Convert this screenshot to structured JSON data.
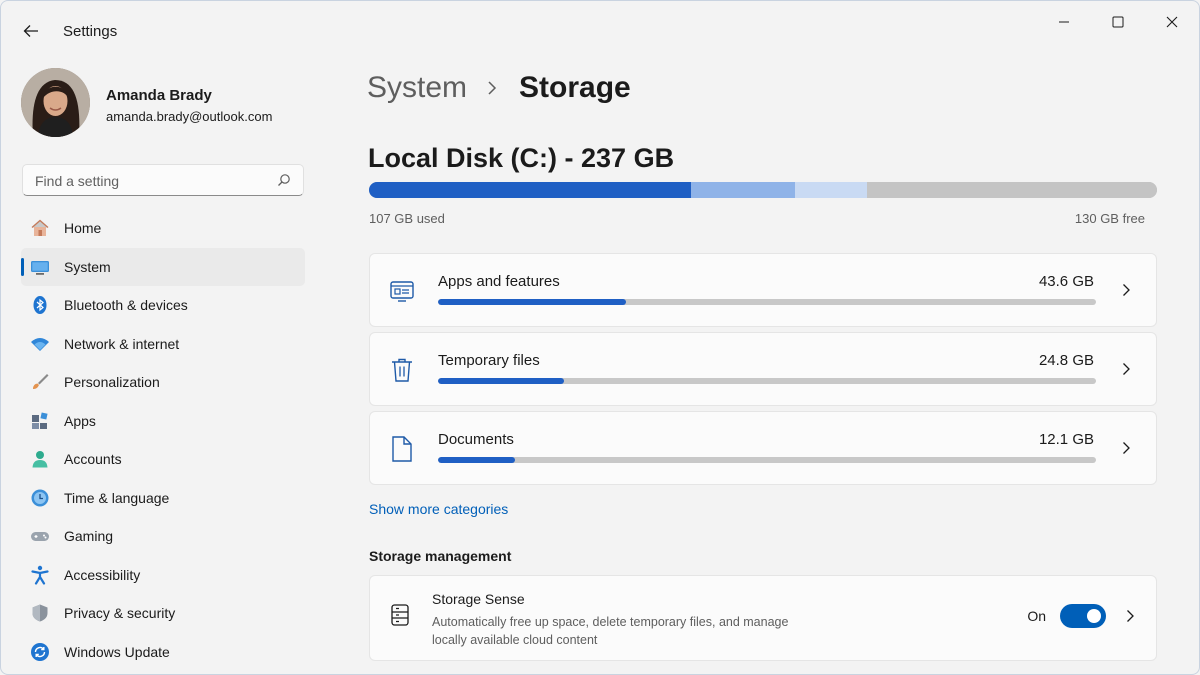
{
  "window": {
    "title": "Settings"
  },
  "profile": {
    "name": "Amanda Brady",
    "email": "amanda.brady@outlook.com"
  },
  "search": {
    "placeholder": "Find a setting"
  },
  "nav": {
    "items": [
      {
        "label": "Home",
        "icon": "home-icon"
      },
      {
        "label": "System",
        "icon": "system-icon",
        "active": true
      },
      {
        "label": "Bluetooth & devices",
        "icon": "bluetooth-icon"
      },
      {
        "label": "Network & internet",
        "icon": "wifi-icon"
      },
      {
        "label": "Personalization",
        "icon": "brush-icon"
      },
      {
        "label": "Apps",
        "icon": "apps-icon"
      },
      {
        "label": "Accounts",
        "icon": "accounts-icon"
      },
      {
        "label": "Time & language",
        "icon": "clock-globe-icon"
      },
      {
        "label": "Gaming",
        "icon": "gamepad-icon"
      },
      {
        "label": "Accessibility",
        "icon": "accessibility-icon"
      },
      {
        "label": "Privacy & security",
        "icon": "shield-icon"
      },
      {
        "label": "Windows Update",
        "icon": "update-icon"
      }
    ]
  },
  "breadcrumb": {
    "parent": "System",
    "current": "Storage"
  },
  "disk": {
    "title": "Local Disk (C:) - 237 GB",
    "used_label": "107 GB used",
    "free_label": "130 GB free",
    "segments": [
      {
        "name": "apps",
        "fraction": 0.408,
        "color": "#1f5fc4"
      },
      {
        "name": "temp",
        "fraction": 0.132,
        "color": "#8fb3e8"
      },
      {
        "name": "docs",
        "fraction": 0.092,
        "color": "#c9daf3"
      },
      {
        "name": "free",
        "fraction": 0.368,
        "color": "#c4c4c4"
      }
    ]
  },
  "categories": [
    {
      "label": "Apps and features",
      "size": "43.6 GB",
      "fraction": 0.285,
      "icon": "apps-features-icon"
    },
    {
      "label": "Temporary files",
      "size": "24.8 GB",
      "fraction": 0.192,
      "icon": "trash-icon"
    },
    {
      "label": "Documents",
      "size": "12.1 GB",
      "fraction": 0.117,
      "icon": "document-icon"
    }
  ],
  "show_more": "Show more categories",
  "storage_management": {
    "header": "Storage management",
    "storage_sense": {
      "title": "Storage Sense",
      "description": "Automatically free up space, delete temporary files, and manage locally available cloud content",
      "toggle_label": "On",
      "enabled": true
    }
  },
  "colors": {
    "accent": "#005fb8",
    "bar_fill": "#1f5fc4"
  }
}
